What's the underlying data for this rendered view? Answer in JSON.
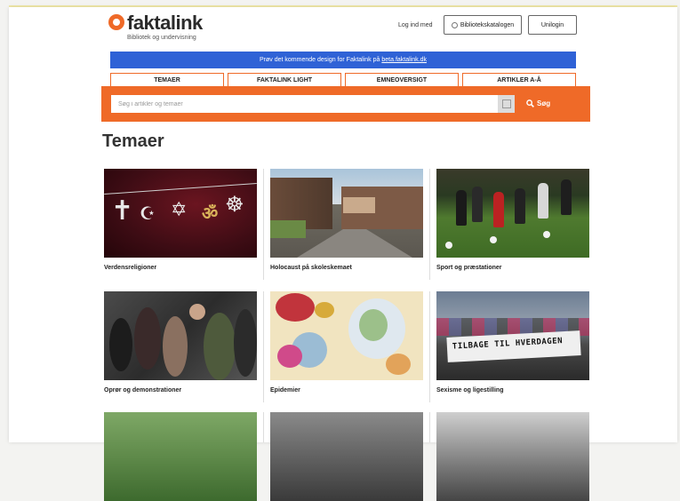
{
  "colors": {
    "accent": "#ef6a28",
    "banner": "#2f62d6",
    "text": "#222222"
  },
  "header": {
    "logo_name": "faktalink",
    "logo_sub": "Bibliotek og undervisning",
    "login_text": "Log ind med",
    "catalog_button": "Bibliotekskatalogen",
    "login_button": "Unilogin"
  },
  "banner": {
    "text": "Prøv det kommende design for Faktalink på",
    "link": "beta.faktalink.dk"
  },
  "tabs": [
    "TEMAER",
    "FAKTALINK LIGHT",
    "EMNEOVERSIGT",
    "ARTIKLER A-Å"
  ],
  "search": {
    "placeholder": "Søg i artikler og temaer",
    "button_label": "Søg"
  },
  "page_title": "Temaer",
  "themes": [
    {
      "title": "Verdensreligioner"
    },
    {
      "title": "Holocaust på skoleskemaet"
    },
    {
      "title": "Sport og præstationer"
    },
    {
      "title": "Oprør og demonstrationer"
    },
    {
      "title": "Epidemier"
    },
    {
      "title": "Sexisme og ligestilling"
    }
  ],
  "image_texts": {
    "sexism_banner": "TILBAGE TIL HVERDAGEN"
  }
}
